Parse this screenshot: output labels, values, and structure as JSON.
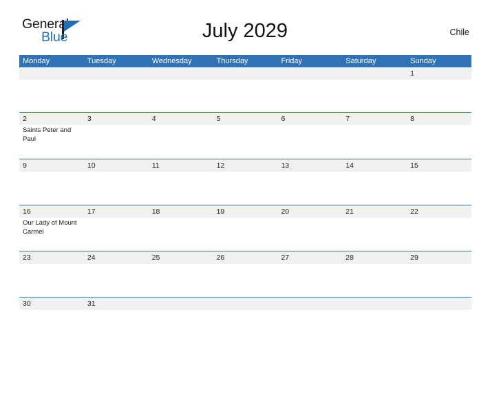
{
  "brand": {
    "name_part1": "General",
    "name_part2": "Blue",
    "flag_icon": "blue-pennant-flag-icon",
    "accent_color": "#2072b8"
  },
  "header": {
    "title": "July 2029",
    "region": "Chile"
  },
  "theme": {
    "header_blue": "#3072b4",
    "row_band_gray": "#f1f1f1",
    "separator_blue": "#3072b4",
    "page_background": "#ffffff",
    "text_color": "#1a1a1a"
  },
  "calendar": {
    "month": "July",
    "year": "2029",
    "country": "Chile",
    "week_start": "Monday",
    "day_headers": [
      "Monday",
      "Tuesday",
      "Wednesday",
      "Thursday",
      "Friday",
      "Saturday",
      "Sunday"
    ],
    "weeks": [
      {
        "days": [
          {
            "num": "",
            "events": []
          },
          {
            "num": "",
            "events": []
          },
          {
            "num": "",
            "events": []
          },
          {
            "num": "",
            "events": []
          },
          {
            "num": "",
            "events": []
          },
          {
            "num": "",
            "events": []
          },
          {
            "num": "1",
            "events": []
          }
        ]
      },
      {
        "days": [
          {
            "num": "2",
            "events": [
              "Saints Peter and Paul"
            ]
          },
          {
            "num": "3",
            "events": []
          },
          {
            "num": "4",
            "events": []
          },
          {
            "num": "5",
            "events": []
          },
          {
            "num": "6",
            "events": []
          },
          {
            "num": "7",
            "events": []
          },
          {
            "num": "8",
            "events": []
          }
        ]
      },
      {
        "days": [
          {
            "num": "9",
            "events": []
          },
          {
            "num": "10",
            "events": []
          },
          {
            "num": "11",
            "events": []
          },
          {
            "num": "12",
            "events": []
          },
          {
            "num": "13",
            "events": []
          },
          {
            "num": "14",
            "events": []
          },
          {
            "num": "15",
            "events": []
          }
        ]
      },
      {
        "days": [
          {
            "num": "16",
            "events": [
              "Our Lady of Mount Carmel"
            ]
          },
          {
            "num": "17",
            "events": []
          },
          {
            "num": "18",
            "events": []
          },
          {
            "num": "19",
            "events": []
          },
          {
            "num": "20",
            "events": []
          },
          {
            "num": "21",
            "events": []
          },
          {
            "num": "22",
            "events": []
          }
        ]
      },
      {
        "days": [
          {
            "num": "23",
            "events": []
          },
          {
            "num": "24",
            "events": []
          },
          {
            "num": "25",
            "events": []
          },
          {
            "num": "26",
            "events": []
          },
          {
            "num": "27",
            "events": []
          },
          {
            "num": "28",
            "events": []
          },
          {
            "num": "29",
            "events": []
          }
        ]
      },
      {
        "days": [
          {
            "num": "30",
            "events": []
          },
          {
            "num": "31",
            "events": []
          },
          {
            "num": "",
            "events": []
          },
          {
            "num": "",
            "events": []
          },
          {
            "num": "",
            "events": []
          },
          {
            "num": "",
            "events": []
          },
          {
            "num": "",
            "events": []
          }
        ]
      }
    ]
  }
}
